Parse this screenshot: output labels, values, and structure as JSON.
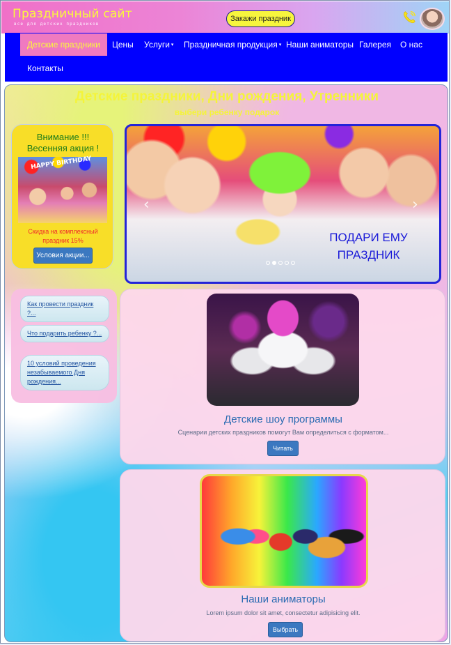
{
  "header": {
    "site_title": "Праздничный сайт",
    "site_subtitle": "все для детских праздников",
    "order_button": "Закажи праздник",
    "phone_icon": "phone-icon",
    "avatar_icon": "operator-avatar"
  },
  "nav": {
    "items": [
      {
        "label": "Детские праздники",
        "active": true,
        "dropdown": false
      },
      {
        "label": "Цены",
        "active": false,
        "dropdown": false
      },
      {
        "label": "Услуги",
        "active": false,
        "dropdown": true
      },
      {
        "label": "Праздничная продукция",
        "active": false,
        "dropdown": true
      },
      {
        "label": "Наши аниматоры",
        "active": false,
        "dropdown": false
      },
      {
        "label": "Галерея",
        "active": false,
        "dropdown": false
      },
      {
        "label": "О нас",
        "active": false,
        "dropdown": false
      },
      {
        "label": "Контакты",
        "active": false,
        "dropdown": false
      }
    ],
    "caret": "▾"
  },
  "main": {
    "title": "Детские праздники, Дни рождения, Утренники",
    "subtitle": "выбери ребенку подарок"
  },
  "promo": {
    "title_line1": "Внимание !!!",
    "title_line2": "Весенняя акция !",
    "image_text": "HAPPY BIRTHDAY",
    "desc_line1": "Скидка на комплексный",
    "desc_line2": "праздник 15%",
    "button": "Условия акции..."
  },
  "carousel": {
    "caption_line1": "ПОДАРИ ЕМУ",
    "caption_line2": "ПРАЗДНИК",
    "prev": "‹",
    "next": "›",
    "slide_count": 5,
    "active_slide": 2
  },
  "side_links": [
    {
      "label": "Как провести праздник ?..."
    },
    {
      "label": "Что подарить ребенку ?..."
    },
    {
      "label": "10 условий проведения незабываемого Дня рождения..."
    }
  ],
  "cards": [
    {
      "title": "Детские шоу программы",
      "desc": "Сценарии детских праздников помогут Вам определиться с форматом...",
      "button": "Читать"
    },
    {
      "title": "Наши аниматоры",
      "desc": "Lorem ipsum dolor sit amet, consectetur adipisicing elit.",
      "button": "Выбрать"
    }
  ],
  "colors": {
    "nav_bg": "#0000ff",
    "active_nav": "#f07ac0",
    "title_yellow": "#f4f43a",
    "button_blue": "#3b78c0",
    "carousel_border": "#2424d8"
  }
}
